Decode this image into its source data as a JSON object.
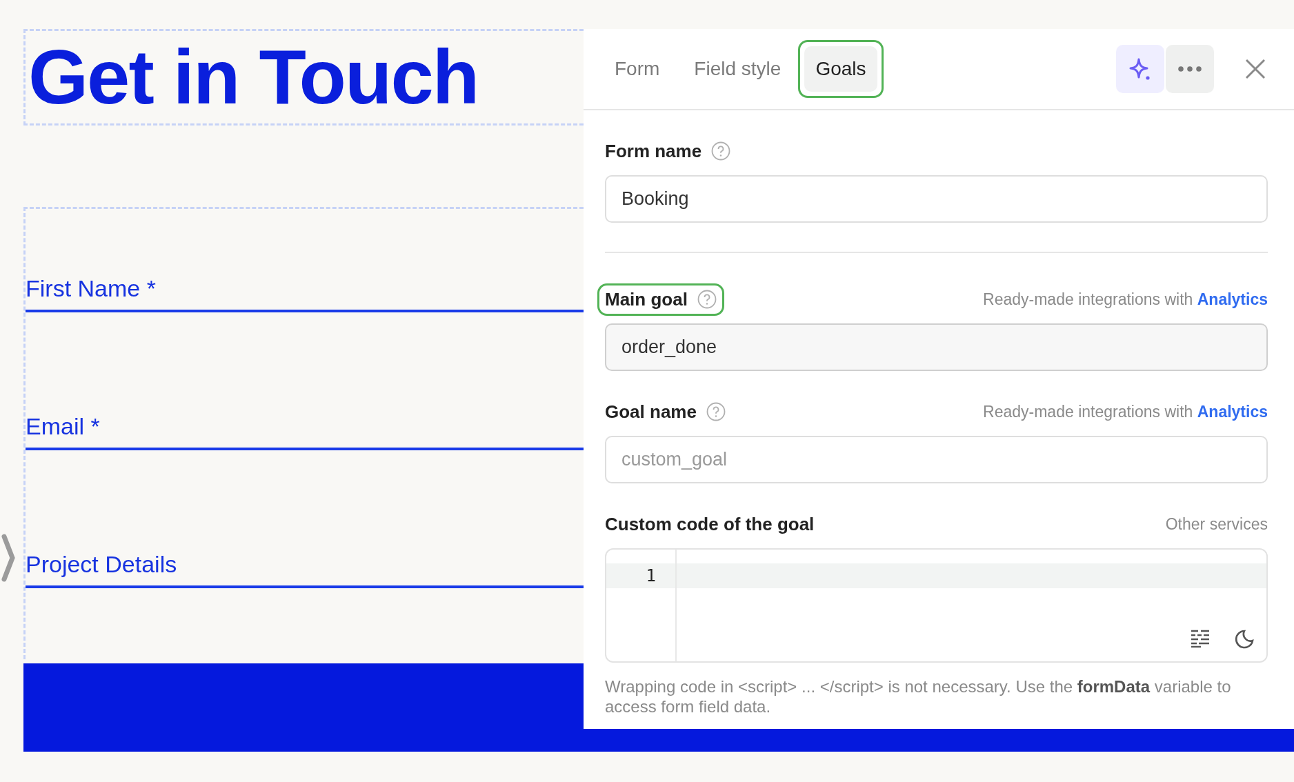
{
  "canvas": {
    "title": "Get in Touch",
    "fields": [
      {
        "label": "First Name *"
      },
      {
        "label": "Email *"
      },
      {
        "label": "Project Details"
      }
    ]
  },
  "panel": {
    "tabs": [
      {
        "label": "Form",
        "selected": false,
        "highlighted": false
      },
      {
        "label": "Field style",
        "selected": false,
        "highlighted": false
      },
      {
        "label": "Goals",
        "selected": true,
        "highlighted": true
      }
    ],
    "fields": [
      {
        "kind": "text",
        "label": "Form name",
        "help": true,
        "value": "Booking",
        "divider": true
      },
      {
        "kind": "text",
        "label": "Main goal",
        "help": true,
        "highlighted": true,
        "note": "Ready-made integrations with",
        "link": "Analytics",
        "value": "order_done"
      },
      {
        "kind": "text",
        "label": "Goal name",
        "help": true,
        "note": "Ready-made integrations with",
        "link": "Analytics",
        "placeholder": "custom_goal"
      },
      {
        "kind": "code",
        "label": "Custom code of the goal",
        "note": "Other services",
        "line_numbers": [
          "1"
        ]
      }
    ],
    "hint": "Wrapping code in <script> ... </script> is not necessary. Use the **formData** variable to access form field data."
  }
}
